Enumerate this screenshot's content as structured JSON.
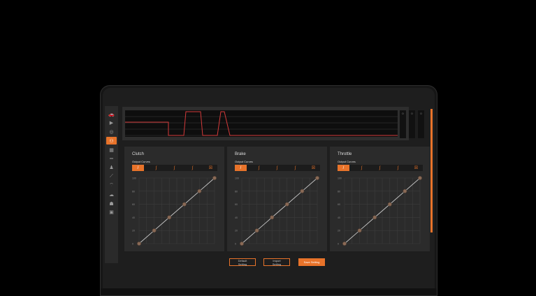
{
  "sidebar": {
    "items": [
      {
        "icon": "car-icon",
        "glyph": "🚗"
      },
      {
        "icon": "video-icon",
        "glyph": "▶"
      },
      {
        "icon": "wheel-icon",
        "glyph": "◎"
      },
      {
        "icon": "pedals-icon",
        "glyph": "⚇",
        "active": true
      },
      {
        "icon": "gear-icon",
        "glyph": "▦"
      },
      {
        "icon": "handbrake-icon",
        "glyph": "═"
      },
      {
        "icon": "seat-icon",
        "glyph": "♟"
      },
      {
        "icon": "shifter-icon",
        "glyph": "⟋"
      },
      {
        "icon": "wifi-icon",
        "glyph": "⌔"
      },
      {
        "icon": "cloud-icon",
        "glyph": "☁"
      },
      {
        "icon": "user-icon",
        "glyph": "☗"
      },
      {
        "icon": "settings-icon",
        "glyph": "▣"
      }
    ]
  },
  "meters": [
    "0",
    "0",
    "0"
  ],
  "panels": [
    {
      "title": "Clutch",
      "curves_label": "Output Curves",
      "presets": [
        "/",
        "∫",
        "∫",
        "∫",
        "☒"
      ],
      "active_preset": 0,
      "y_ticks": [
        "100",
        "80",
        "60",
        "40",
        "20",
        "0"
      ],
      "points": [
        [
          0,
          0
        ],
        [
          20,
          20
        ],
        [
          40,
          40
        ],
        [
          60,
          60
        ],
        [
          80,
          80
        ],
        [
          100,
          100
        ]
      ]
    },
    {
      "title": "Brake",
      "curves_label": "Output Curves",
      "presets": [
        "/",
        "∫",
        "∫",
        "∫",
        "☒"
      ],
      "active_preset": 0,
      "y_ticks": [
        "100",
        "80",
        "60",
        "40",
        "20",
        "0"
      ],
      "points": [
        [
          0,
          0
        ],
        [
          20,
          20
        ],
        [
          40,
          40
        ],
        [
          60,
          60
        ],
        [
          80,
          80
        ],
        [
          100,
          100
        ]
      ]
    },
    {
      "title": "Throttle",
      "curves_label": "Output Curves",
      "presets": [
        "/",
        "∫",
        "∫",
        "∫",
        "☒"
      ],
      "active_preset": 0,
      "y_ticks": [
        "100",
        "80",
        "60",
        "40",
        "20",
        "0"
      ],
      "points": [
        [
          0,
          0
        ],
        [
          20,
          20
        ],
        [
          40,
          40
        ],
        [
          60,
          60
        ],
        [
          80,
          80
        ],
        [
          100,
          100
        ]
      ]
    }
  ],
  "buttons": {
    "default": "Default Setting",
    "import": "Import Setting",
    "save": "Save Setting"
  },
  "colors": {
    "accent": "#e8732a",
    "signal": "#d43a3a"
  }
}
